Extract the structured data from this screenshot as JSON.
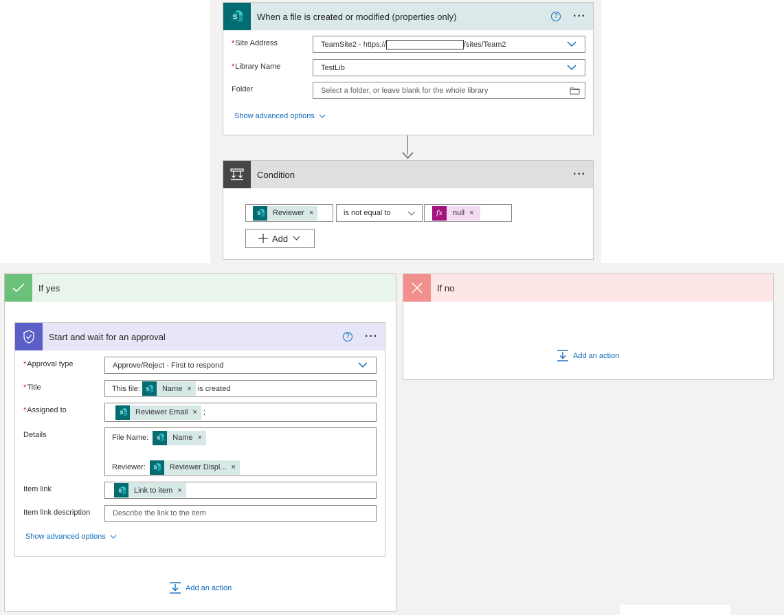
{
  "trigger": {
    "title": "When a file is created or modified (properties only)",
    "help": "?",
    "more": "···",
    "site_address_label": "Site Address",
    "site_address_prefix": "TeamSite2 - https://",
    "site_address_suffix": "/sites/Team2",
    "library_label": "Library Name",
    "library_value": "TestLib",
    "folder_label": "Folder",
    "folder_placeholder": "Select a folder, or leave blank for the whole library",
    "advanced": "Show advanced options",
    "required_mark": "*"
  },
  "condition": {
    "title": "Condition",
    "more": "···",
    "left_token": "Reviewer",
    "operator": "is not equal to",
    "right_token": "null",
    "fx": "fx",
    "add_label": "Add",
    "token_close": "×"
  },
  "if_yes": {
    "title": "If yes",
    "add_action": "Add an action"
  },
  "if_no": {
    "title": "If no",
    "add_action": "Add an action"
  },
  "approval": {
    "title": "Start and wait for an approval",
    "help": "?",
    "more": "···",
    "approval_type_label": "Approval type",
    "approval_type_value": "Approve/Reject - First to respond",
    "title_label": "Title",
    "title_prefix": "This file:",
    "title_token": "Name",
    "title_suffix": "is created",
    "assigned_label": "Assigned to",
    "assigned_token": "Reviewer Email",
    "assigned_suffix": ";",
    "details_label": "Details",
    "details_file_label": "File Name:",
    "details_file_token": "Name",
    "details_reviewer_label": "Reviewer:",
    "details_reviewer_token": "Reviewer Displ...",
    "item_link_label": "Item link",
    "item_link_token": "Link to item",
    "item_link_desc_label": "Item link description",
    "item_link_desc_placeholder": "Describe the link to the item",
    "advanced": "Show advanced options",
    "required_mark": "*",
    "token_close": "×"
  },
  "colors": {
    "sharepoint": "#036c70",
    "approval": "#5b5fc7",
    "yes": "#6bc07a",
    "no": "#f1908c",
    "link": "#0f6cbd"
  }
}
